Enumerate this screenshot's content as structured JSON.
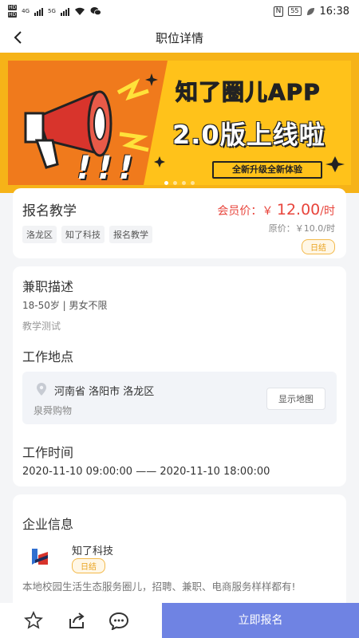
{
  "status_bar": {
    "left_badges": [
      "HD",
      "HD"
    ],
    "signal_labels": [
      "4G",
      "5G"
    ],
    "nfc": "N",
    "battery": "55",
    "time": "16:38"
  },
  "header": {
    "title": "职位详情",
    "back_icon": "chevron-left-icon"
  },
  "banner": {
    "line1": "知了圈儿APP",
    "line2": "2.0版上线啦",
    "pill": "全新升级全新体验",
    "exclaim": "!!!",
    "page_count": 4,
    "active_index": 0,
    "colors": {
      "background": "#ffc21a",
      "rays": "#f07a1c",
      "megaphone": "#d8342c"
    }
  },
  "job": {
    "title": "报名教学",
    "member_price_label": "会员价：",
    "member_price_currency": "￥",
    "member_price_value": "12.00",
    "member_price_unit": "/时",
    "original_price": "原价：￥10.0/时",
    "tags": [
      "洛龙区",
      "知了科技",
      "报名教学"
    ],
    "settlement": "日结"
  },
  "description": {
    "title": "兼职描述",
    "requirement": "18-50岁 | 男女不限",
    "detail": "教学测试"
  },
  "location": {
    "title": "工作地点",
    "address": "河南省 洛阳市 洛龙区",
    "place": "泉舜购物",
    "map_button": "显示地图"
  },
  "work_time": {
    "title": "工作时间",
    "range": "2020-11-10 09:00:00 —— 2020-11-10 18:00:00"
  },
  "company": {
    "title": "企业信息",
    "name": "知了科技",
    "badge": "日结",
    "description": "本地校园生活生态服务圈儿，招聘、兼职、电商服务样样都有!"
  },
  "bottom_bar": {
    "icons": [
      "star-icon",
      "share-icon",
      "chat-icon"
    ],
    "apply_label": "立即报名",
    "apply_color": "#6f83e3"
  }
}
